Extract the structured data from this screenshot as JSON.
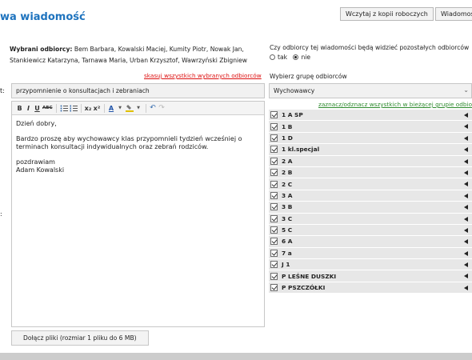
{
  "header": {
    "title": "wa wiadomość",
    "buttons": [
      "Wczytaj z kopii roboczych",
      "Wiadomości"
    ]
  },
  "recipients": {
    "label": "Wybrani odbiorcy:",
    "line1": "Bem Barbara, Kowalski Maciej, Kumity Piotr, Nowak Jan,",
    "line2": "Stankiewicz Katarzyna, Tarnawa Maria, Urban Krzysztof, Wawrzyński Zbigniew",
    "clear_link": "skasuj wszystkich wybranych odbiorców"
  },
  "visibility": {
    "question": "Czy odbiorcy tej wiadomości będą widzieć pozostałych odbiorców",
    "options": [
      "tak",
      "nie"
    ],
    "selected": "nie"
  },
  "subject": {
    "label": "t:",
    "value": "przypomnienie o konsultacjach i zebraniach"
  },
  "editor": {
    "toolbar": [
      "B",
      "I",
      "U",
      "ABC",
      "bulleted-list",
      "numbered-list",
      "x₂",
      "x²",
      "A",
      "highlight",
      "undo",
      "redo"
    ],
    "stray_label": ":",
    "paragraphs": [
      "Dzień dobry,",
      "Bardzo proszę aby wychowawcy klas przypomnieli tydzień wcześniej o terminach konsultacji indywidualnych oraz zebrań rodziców.",
      "pozdrawiam",
      "Adam Kowalski"
    ]
  },
  "groups": {
    "label": "Wybierz grupę odbiorców",
    "selected": "Wychowawcy",
    "toggle_link": "zaznacz/odznacz wszystkich w bieżącej grupie odbiorców",
    "items": [
      "1 A SP",
      "1 B",
      "1 D",
      "1 kl.specjal",
      "2 A",
      "2 B",
      "2 C",
      "3 A",
      "3 B",
      "3 C",
      "5 C",
      "6 A",
      "7 a",
      "J 1",
      "P LEŚNE DUSZKI",
      "P PSZCZÓŁKI"
    ]
  },
  "attach_button": "Dołącz pliki (rozmiar 1 pliku do 6 MB)",
  "colors": {
    "title": "#1e73be",
    "clear_link": "#dd1111",
    "toggle_link": "#2e8b2e",
    "group_row": "#e7e7e7"
  }
}
